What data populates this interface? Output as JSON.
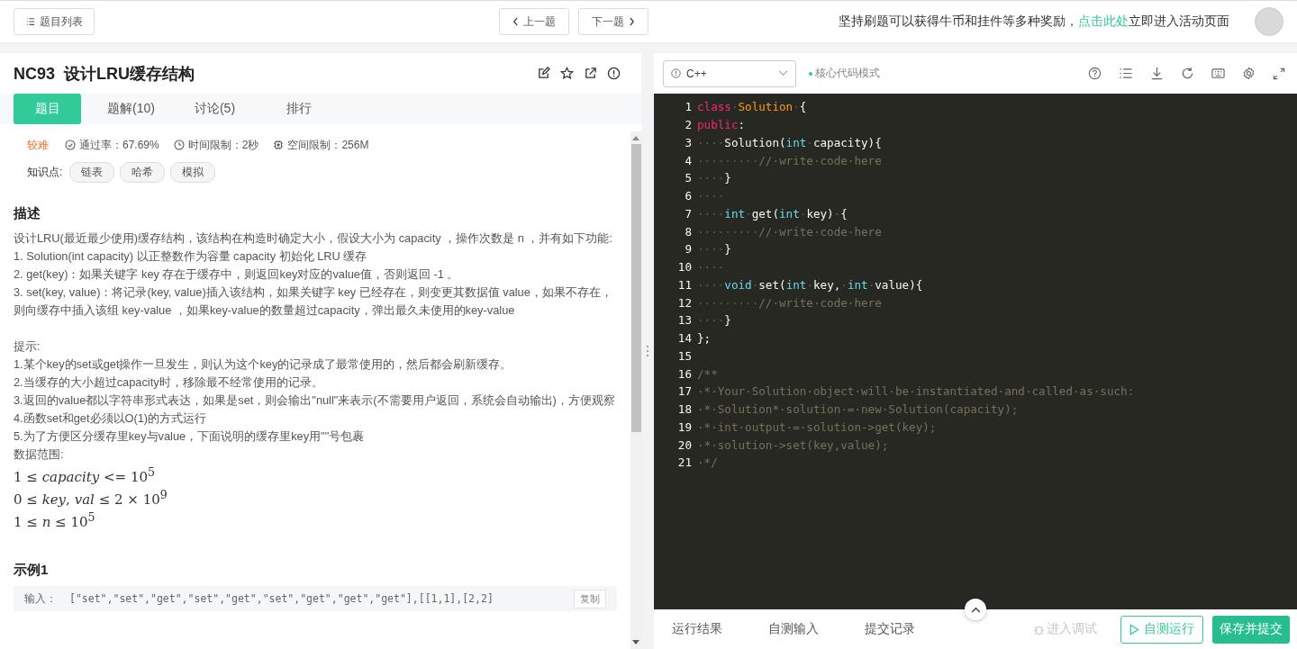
{
  "top_bar": {
    "problem_list_button": "题目列表",
    "prev_button": "上一题",
    "next_button": "下一题",
    "promo": {
      "before": "坚持刷题可以获得牛币和挂件等多种奖励，",
      "link": "点击此处",
      "after": "立即进入活动页面"
    }
  },
  "problem": {
    "title": "NC93  设计LRU缓存结构",
    "tabs": [
      {
        "label": "题目",
        "selected": true
      },
      {
        "label": "题解(10)",
        "selected": false
      },
      {
        "label": "讨论(5)",
        "selected": false
      },
      {
        "label": "排行",
        "selected": false
      }
    ],
    "difficulty": "较难",
    "pass_rate": "通过率：67.69%",
    "time_limit": "时间限制：2秒",
    "memory_limit": "空间限制：256M",
    "tags_label": "知识点:",
    "tags": [
      "链表",
      "哈希",
      "模拟"
    ],
    "description_heading": "描述",
    "description": [
      "设计LRU(最近最少使用)缓存结构，该结构在构造时确定大小，假设大小为 capacity ，操作次数是 n ，并有如下功能:",
      "1. Solution(int capacity) 以正整数作为容量 capacity 初始化 LRU 缓存",
      "2. get(key)：如果关键字 key 存在于缓存中，则返回key对应的value值，否则返回 -1 。",
      "3. set(key, value)：将记录(key, value)插入该结构，如果关键字 key 已经存在，则变更其数据值 value，如果不存在，则向缓存中插入该组 key-value ，如果key-value的数量超过capacity，弹出最久未使用的key-value"
    ],
    "hints": [
      "提示:",
      "1.某个key的set或get操作一旦发生，则认为这个key的记录成了最常使用的，然后都会刷新缓存。",
      "2.当缓存的大小超过capacity时，移除最不经常使用的记录。",
      "3.返回的value都以字符串形式表达，如果是set，则会输出\"null\"来表示(不需要用户返回，系统会自动输出)，方便观察",
      "4.函数set和get必须以O(1)的方式运行",
      "5.为了方便区分缓存里key与value，下面说明的缓存里key用\"\"号包裹",
      "数据范围:"
    ],
    "ranges": [
      "1 ≤ *capacity* <= 10$^{5}$",
      "0 ≤ *key*, *val* ≤ 2 × 10$^{9}$",
      "1 ≤ *n* ≤ 10$^{5}$"
    ],
    "example_heading": "示例1",
    "example_input_label": "输入：",
    "example_input": "[\"set\",\"set\",\"get\",\"set\",\"get\",\"set\",\"get\",\"get\",\"get\"],[[1,1],[2,2]",
    "copy_button": "复制"
  },
  "editor": {
    "language": "C++",
    "mode": "核心代码模式",
    "lines": [
      {
        "no": "1",
        "tokens": [
          {
            "kind": "kw",
            "t": "class"
          },
          {
            "kind": "ws",
            "t": "·"
          },
          {
            "kind": "cls",
            "t": "Solution"
          },
          {
            "kind": "ws",
            "t": "·"
          },
          {
            "kind": "plain",
            "t": "{"
          }
        ]
      },
      {
        "no": "2",
        "tokens": [
          {
            "kind": "kw",
            "t": "public"
          },
          {
            "kind": "plain",
            "t": ":"
          }
        ]
      },
      {
        "no": "3",
        "tokens": [
          {
            "kind": "ws",
            "t": "····"
          },
          {
            "kind": "plain",
            "t": "Solution("
          },
          {
            "kind": "type",
            "t": "int"
          },
          {
            "kind": "ws",
            "t": "·"
          },
          {
            "kind": "plain",
            "t": "capacity){"
          }
        ]
      },
      {
        "no": "4",
        "tokens": [
          {
            "kind": "ws",
            "t": "·········"
          },
          {
            "kind": "comment",
            "t": "//·write·code·here"
          }
        ]
      },
      {
        "no": "5",
        "tokens": [
          {
            "kind": "ws",
            "t": "····"
          },
          {
            "kind": "plain",
            "t": "}"
          }
        ]
      },
      {
        "no": "6",
        "tokens": [
          {
            "kind": "ws",
            "t": "····"
          }
        ]
      },
      {
        "no": "7",
        "tokens": [
          {
            "kind": "ws",
            "t": "····"
          },
          {
            "kind": "type",
            "t": "int"
          },
          {
            "kind": "ws",
            "t": "·"
          },
          {
            "kind": "plain",
            "t": "get("
          },
          {
            "kind": "type",
            "t": "int"
          },
          {
            "kind": "ws",
            "t": "·"
          },
          {
            "kind": "plain",
            "t": "key)"
          },
          {
            "kind": "ws",
            "t": "·"
          },
          {
            "kind": "plain",
            "t": "{"
          }
        ]
      },
      {
        "no": "8",
        "tokens": [
          {
            "kind": "ws",
            "t": "·········"
          },
          {
            "kind": "comment",
            "t": "//·write·code·here"
          }
        ]
      },
      {
        "no": "9",
        "tokens": [
          {
            "kind": "ws",
            "t": "····"
          },
          {
            "kind": "plain",
            "t": "}"
          }
        ]
      },
      {
        "no": "10",
        "tokens": [
          {
            "kind": "ws",
            "t": "····"
          }
        ]
      },
      {
        "no": "11",
        "tokens": [
          {
            "kind": "ws",
            "t": "····"
          },
          {
            "kind": "type",
            "t": "void"
          },
          {
            "kind": "ws",
            "t": "·"
          },
          {
            "kind": "plain",
            "t": "set("
          },
          {
            "kind": "type",
            "t": "int"
          },
          {
            "kind": "ws",
            "t": "·"
          },
          {
            "kind": "plain",
            "t": "key,"
          },
          {
            "kind": "ws",
            "t": "·"
          },
          {
            "kind": "type",
            "t": "int"
          },
          {
            "kind": "ws",
            "t": "·"
          },
          {
            "kind": "plain",
            "t": "value){"
          }
        ]
      },
      {
        "no": "12",
        "tokens": [
          {
            "kind": "ws",
            "t": "·········"
          },
          {
            "kind": "comment",
            "t": "//·write·code·here"
          }
        ]
      },
      {
        "no": "13",
        "tokens": [
          {
            "kind": "ws",
            "t": "····"
          },
          {
            "kind": "plain",
            "t": "}"
          }
        ]
      },
      {
        "no": "14",
        "tokens": [
          {
            "kind": "plain",
            "t": "};"
          }
        ]
      },
      {
        "no": "15"
      },
      {
        "no": "16",
        "tokens": [
          {
            "kind": "comment",
            "t": "/**"
          }
        ]
      },
      {
        "no": "17",
        "tokens": [
          {
            "kind": "comment",
            "t": "·*·Your·Solution·object·will·be·instantiated·and·called·as·such:"
          }
        ]
      },
      {
        "no": "18",
        "tokens": [
          {
            "kind": "comment",
            "t": "·*·Solution*·solution·=·new·Solution(capacity);"
          }
        ]
      },
      {
        "no": "19",
        "tokens": [
          {
            "kind": "comment",
            "t": "·*·int·output·=·solution->get(key);"
          }
        ]
      },
      {
        "no": "20",
        "tokens": [
          {
            "kind": "comment",
            "t": "·*·solution->set(key,value);"
          }
        ]
      },
      {
        "no": "21",
        "tokens": [
          {
            "kind": "comment",
            "t": "·*/"
          }
        ]
      }
    ],
    "bottom_tabs": [
      "运行结果",
      "自测输入",
      "提交记录"
    ],
    "debug_button": {
      "label": "进入调试",
      "disabled": true
    },
    "run_button": "自测运行",
    "submit_button": "保存并提交"
  }
}
